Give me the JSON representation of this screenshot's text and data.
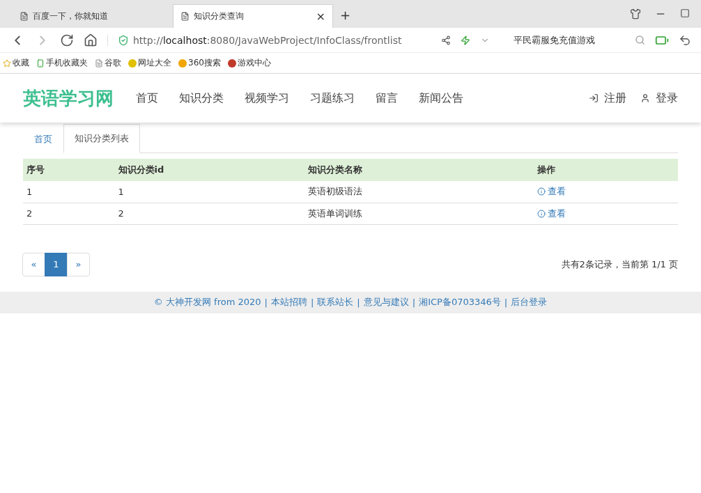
{
  "browser": {
    "tabs": [
      {
        "title": "百度一下，你就知道",
        "selected": false
      },
      {
        "title": "知识分类查询",
        "selected": true
      }
    ],
    "close": "×",
    "new_tab": "+",
    "url_host_prefix": "http://",
    "url_host": "localhost",
    "url_rest": ":8080/JavaWebProject/InfoClass/frontlist",
    "search_hint": "平民霸服免充值游戏",
    "bookmarks": [
      "收藏",
      "手机收藏夹",
      "谷歌",
      "网址大全",
      "360搜索",
      "游戏中心"
    ]
  },
  "navbar": {
    "brand": "英语学习网",
    "items": [
      {
        "label": "首页"
      },
      {
        "label": "知识分类"
      },
      {
        "label": "视频学习"
      },
      {
        "label": "习题练习"
      },
      {
        "label": "留言"
      },
      {
        "label": "新闻公告"
      }
    ],
    "register": "注册",
    "login": "登录"
  },
  "breadcrumb_tabs": [
    {
      "label": "首页",
      "selected": false
    },
    {
      "label": "知识分类列表",
      "selected": true
    }
  ],
  "table": {
    "columns": [
      "序号",
      "知识分类id",
      "知识分类名称",
      "操作"
    ],
    "rows": [
      {
        "cells": [
          "1",
          "1",
          "英语初级语法"
        ],
        "action": "查看"
      },
      {
        "cells": [
          "2",
          "2",
          "英语单词训练"
        ],
        "action": "查看"
      }
    ]
  },
  "pagination": {
    "prev": "«",
    "pages": [
      {
        "label": "1",
        "selected": true
      }
    ],
    "next": "»",
    "summary": "共有2条记录，当前第 1/1 页"
  },
  "footer": {
    "separator": "|",
    "items": [
      "© 大神开发网 from 2020",
      "本站招聘",
      "联系站长",
      "意见与建议",
      "湘ICP备0703346号",
      "后台登录"
    ]
  }
}
